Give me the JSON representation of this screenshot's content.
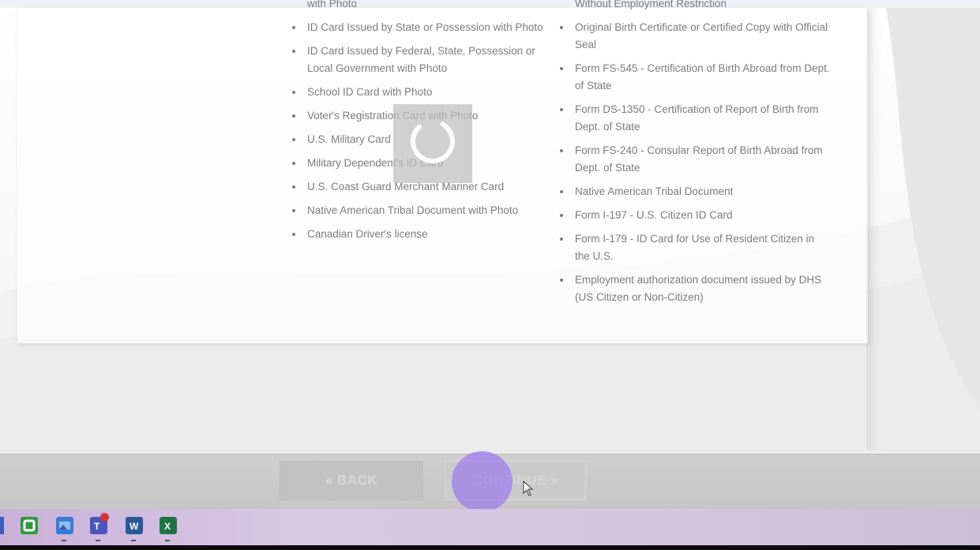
{
  "colors": {
    "text": "#7c7c7c",
    "footer": "#c6c6c6",
    "click_highlight": "#9b6ef0",
    "taskbar": "#d4c5de"
  },
  "left_list": {
    "items": [
      {
        "text": "with Photo",
        "bullet": false
      },
      {
        "text": "ID Card Issued by State or Possession with Photo",
        "bullet": true
      },
      {
        "text": "ID Card Issued by Federal, State, Possession or Local Government with Photo",
        "bullet": true
      },
      {
        "text": "School ID Card with Photo",
        "bullet": true
      },
      {
        "text": "Voter's Registration Card with Photo",
        "bullet": true
      },
      {
        "text": "U.S. Military Card",
        "bullet": true
      },
      {
        "text": "Military Dependent's ID Card",
        "bullet": true
      },
      {
        "text": "U.S. Coast Guard Merchant Mariner Card",
        "bullet": true
      },
      {
        "text": "Native American Tribal Document with Photo",
        "bullet": true
      },
      {
        "text": "Canadian Driver's license",
        "bullet": true
      }
    ]
  },
  "right_list": {
    "items": [
      {
        "text": "Without Employment Restriction",
        "bullet": false
      },
      {
        "text": "Original Birth Certificate or Certified Copy with Official Seal",
        "bullet": true
      },
      {
        "text": "Form FS-545 - Certification of Birth Abroad from Dept. of State",
        "bullet": true
      },
      {
        "text": "Form DS-1350 - Certification of Report of Birth from Dept. of State",
        "bullet": true
      },
      {
        "text": "Form FS-240 - Consular Report of Birth Abroad from Dept. of State",
        "bullet": true
      },
      {
        "text": "Native American Tribal Document",
        "bullet": true
      },
      {
        "text": "Form I-197 - U.S. Citizen ID Card",
        "bullet": true
      },
      {
        "text": "Form I-179 - ID Card for Use of Resident Citizen in the U.S.",
        "bullet": true
      },
      {
        "text": "Employment authorization document issued by DHS (US Citizen or Non-Citizen)",
        "bullet": true
      }
    ]
  },
  "loading": {
    "icon": "loading-spinner-icon"
  },
  "footer": {
    "back_label": "« BACK",
    "continue_label": "CONTINUE »"
  },
  "taskbar": {
    "apps": [
      {
        "name": "camtasia",
        "color": "#2e9a3e"
      },
      {
        "name": "photos",
        "color": "#3a7bd5"
      },
      {
        "name": "teams",
        "color": "#4b53bc",
        "badge": "1"
      },
      {
        "name": "word",
        "color": "#2b579a"
      },
      {
        "name": "excel",
        "color": "#217346"
      }
    ]
  }
}
